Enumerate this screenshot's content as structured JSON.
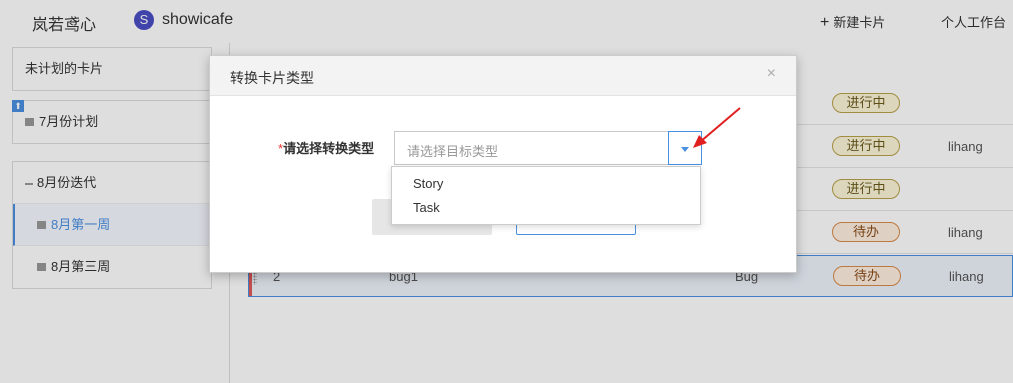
{
  "topbar": {
    "brand": "岚若鸢心",
    "project_avatar": "S",
    "project_name": "showicafe",
    "new_card": "新建卡片",
    "workspace": "个人工作台"
  },
  "sidebar": {
    "unplanned": "未计划的卡片",
    "july_plan": "7月份计划",
    "august_iteration": "8月份迭代",
    "week1": "8月第一周",
    "week3": "8月第三周"
  },
  "table": {
    "rows": [
      {
        "id": "",
        "name": "",
        "type": "",
        "status": "进行中",
        "status_kind": "doing",
        "owner": ""
      },
      {
        "id": "",
        "name": "",
        "type": "",
        "status": "进行中",
        "status_kind": "doing",
        "owner": "lihang"
      },
      {
        "id": "",
        "name": "",
        "type": "",
        "status": "进行中",
        "status_kind": "doing",
        "owner": ""
      },
      {
        "id": "",
        "name": "",
        "type": "",
        "status": "待办",
        "status_kind": "todo",
        "owner": "lihang"
      },
      {
        "id": "2",
        "name": "bug1",
        "type": "Bug",
        "status": "待办",
        "status_kind": "todo",
        "owner": "lihang"
      }
    ]
  },
  "modal": {
    "title": "转换卡片类型",
    "close": "×",
    "required_mark": "*",
    "label": "请选择转换类型",
    "placeholder": "请选择目标类型"
  },
  "dropdown": {
    "options": [
      "Story",
      "Task"
    ]
  },
  "colors": {
    "accent": "#4a90e2",
    "annotation_arrow": "#e02020"
  },
  "icons": {
    "close": "close-icon",
    "caret": "chevron-down-icon",
    "folder": "folder-icon",
    "plus": "plus-icon"
  }
}
